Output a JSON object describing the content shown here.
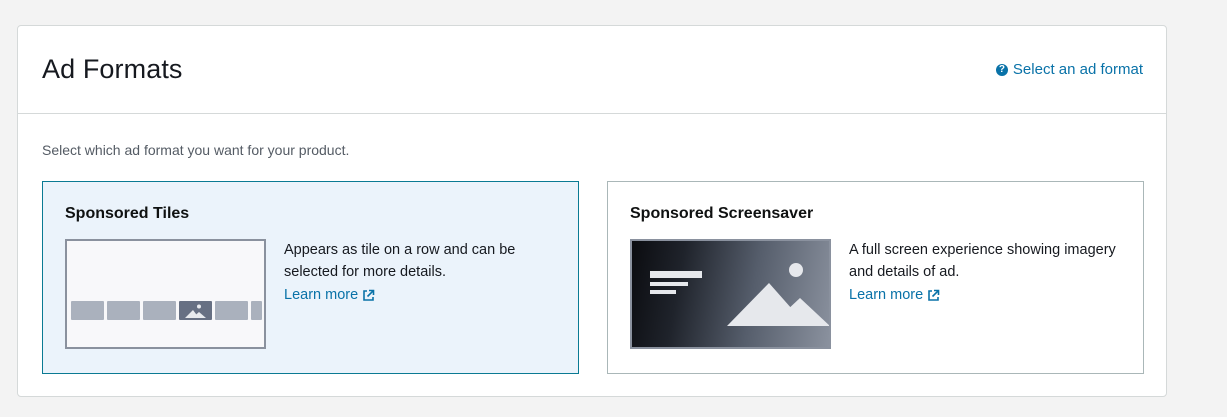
{
  "header": {
    "title": "Ad Formats",
    "help_link": "Select an ad format"
  },
  "instruction": "Select which ad format you want for your product.",
  "cards": [
    {
      "title": "Sponsored Tiles",
      "description": "Appears as tile on a row and can be selected for more details.",
      "learn_more": "Learn more",
      "selected": true,
      "thumbnail_icon": "tiles-row-thumbnail"
    },
    {
      "title": "Sponsored Screensaver",
      "description": "A full screen experience showing imagery and details of ad.",
      "learn_more": "Learn more",
      "selected": false,
      "thumbnail_icon": "screensaver-thumbnail"
    }
  ],
  "colors": {
    "link": "#0972a8",
    "selected_border": "#0a7a93",
    "selected_background": "#ebf3fb"
  }
}
